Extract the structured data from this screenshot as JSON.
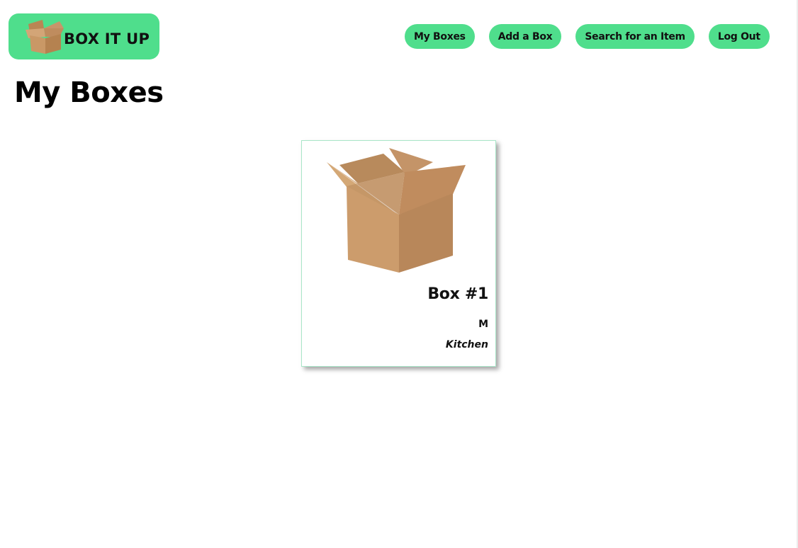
{
  "header": {
    "logo_text": "BOX IT UP",
    "logo_icon": "cardboard-box-icon",
    "accent_color": "#4fde8c"
  },
  "nav": {
    "items": [
      {
        "label": "My Boxes"
      },
      {
        "label": "Add a Box"
      },
      {
        "label": "Search for an Item"
      },
      {
        "label": "Log Out"
      }
    ]
  },
  "main": {
    "title": "My Boxes",
    "boxes": [
      {
        "name": "Box #1",
        "size": "M",
        "room": "Kitchen",
        "image": "open-cardboard-box"
      }
    ]
  }
}
